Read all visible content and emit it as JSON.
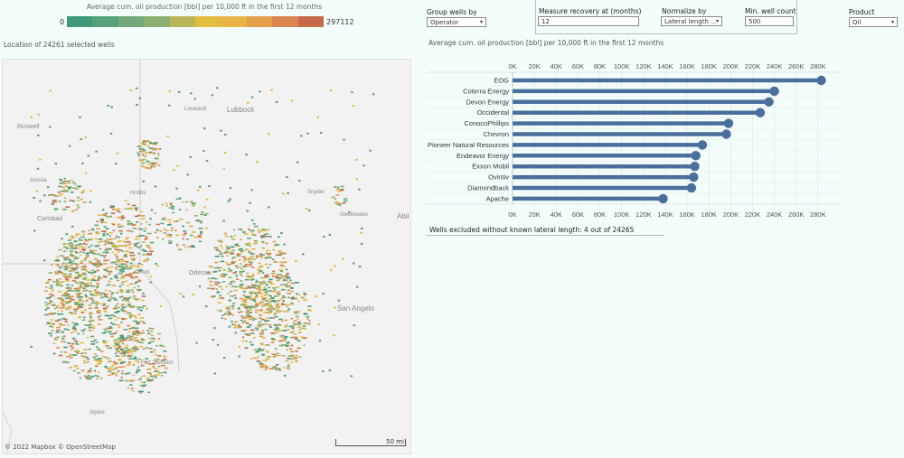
{
  "legend": {
    "title": "Average cum. oil production [bbl] per 10,000 ft in the first 12 months",
    "min": "0",
    "max": "297112",
    "colors": [
      "#3e9a77",
      "#56a179",
      "#71a97a",
      "#8cb071",
      "#b7b658",
      "#e2bc3f",
      "#e9b447",
      "#e39f4c",
      "#d8864d",
      "#c86a4a"
    ]
  },
  "map": {
    "caption": "Location of 24261 selected wells",
    "places": [
      "Lubbock",
      "Roswell",
      "Loveland",
      "Artesia",
      "Carlsbad",
      "Hobbs",
      "Snyder",
      "Sweetwater",
      "Abil",
      "Odessa",
      "Kermit",
      "San Angelo",
      "Fort Stockton",
      "Alpine"
    ],
    "credit": "© 2022 Mapbox  © OpenStreetMap",
    "scale": "50 mi"
  },
  "controls": {
    "group_by": {
      "label": "Group wells by",
      "value": "Operator"
    },
    "recovery": {
      "label": "Measure recovery at (months)",
      "value": "12"
    },
    "normalize": {
      "label": "Normalize by",
      "value": "Lateral length ..."
    },
    "min_count": {
      "label": "Min. well count",
      "value": "500"
    },
    "product": {
      "label": "Product",
      "value": "Oil"
    }
  },
  "chart_caption": "Average cum. oil production [bbl] per 10,000 ft in the first 12 months",
  "chart_data": {
    "type": "bar",
    "style": "lollipop",
    "color": "#4b6f9c",
    "categories": [
      "EOG",
      "Coterra Energy",
      "Devon Energy",
      "Occidental",
      "ConocoPhillips",
      "Chevron",
      "Pioneer Natural Resources",
      "Endeavor Energy",
      "Exxon Mobil",
      "Ovintiv",
      "Diamondback",
      "Apache"
    ],
    "values": [
      283000,
      240000,
      235000,
      227000,
      198000,
      196000,
      174000,
      168000,
      167000,
      166000,
      164000,
      138000
    ],
    "xlim": [
      0,
      300000
    ],
    "ticks": [
      "0K",
      "20K",
      "40K",
      "60K",
      "80K",
      "100K",
      "120K",
      "140K",
      "160K",
      "180K",
      "200K",
      "220K",
      "240K",
      "260K",
      "280K"
    ]
  },
  "footer": "Wells excluded without known lateral length: 4 out of 24265"
}
